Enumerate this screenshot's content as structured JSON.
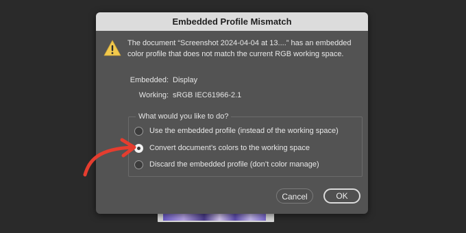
{
  "dialog": {
    "title": "Embedded Profile Mismatch",
    "message": "The document “Screenshot 2024-04-04 at 13....” has an embedded color profile that does not match the current RGB working space.",
    "embedded_label": "Embedded:",
    "embedded_value": "Display",
    "working_label": "Working:",
    "working_value": "sRGB IEC61966-2.1",
    "group_title": "What would you like to do?",
    "options": [
      {
        "label": "Use the embedded profile (instead of the working space)",
        "selected": false
      },
      {
        "label": "Convert document’s colors to the working space",
        "selected": true
      },
      {
        "label": "Discard the embedded profile (don’t color manage)",
        "selected": false
      }
    ],
    "cancel_label": "Cancel",
    "ok_label": "OK"
  },
  "icons": {
    "warning": "warning-icon",
    "annotation": "annotation-arrow"
  },
  "colors": {
    "dialog_bg": "#535353",
    "titlebar_bg": "#dcdcdc",
    "warning_fill": "#f2c94c",
    "annotation": "#e53d2f"
  }
}
